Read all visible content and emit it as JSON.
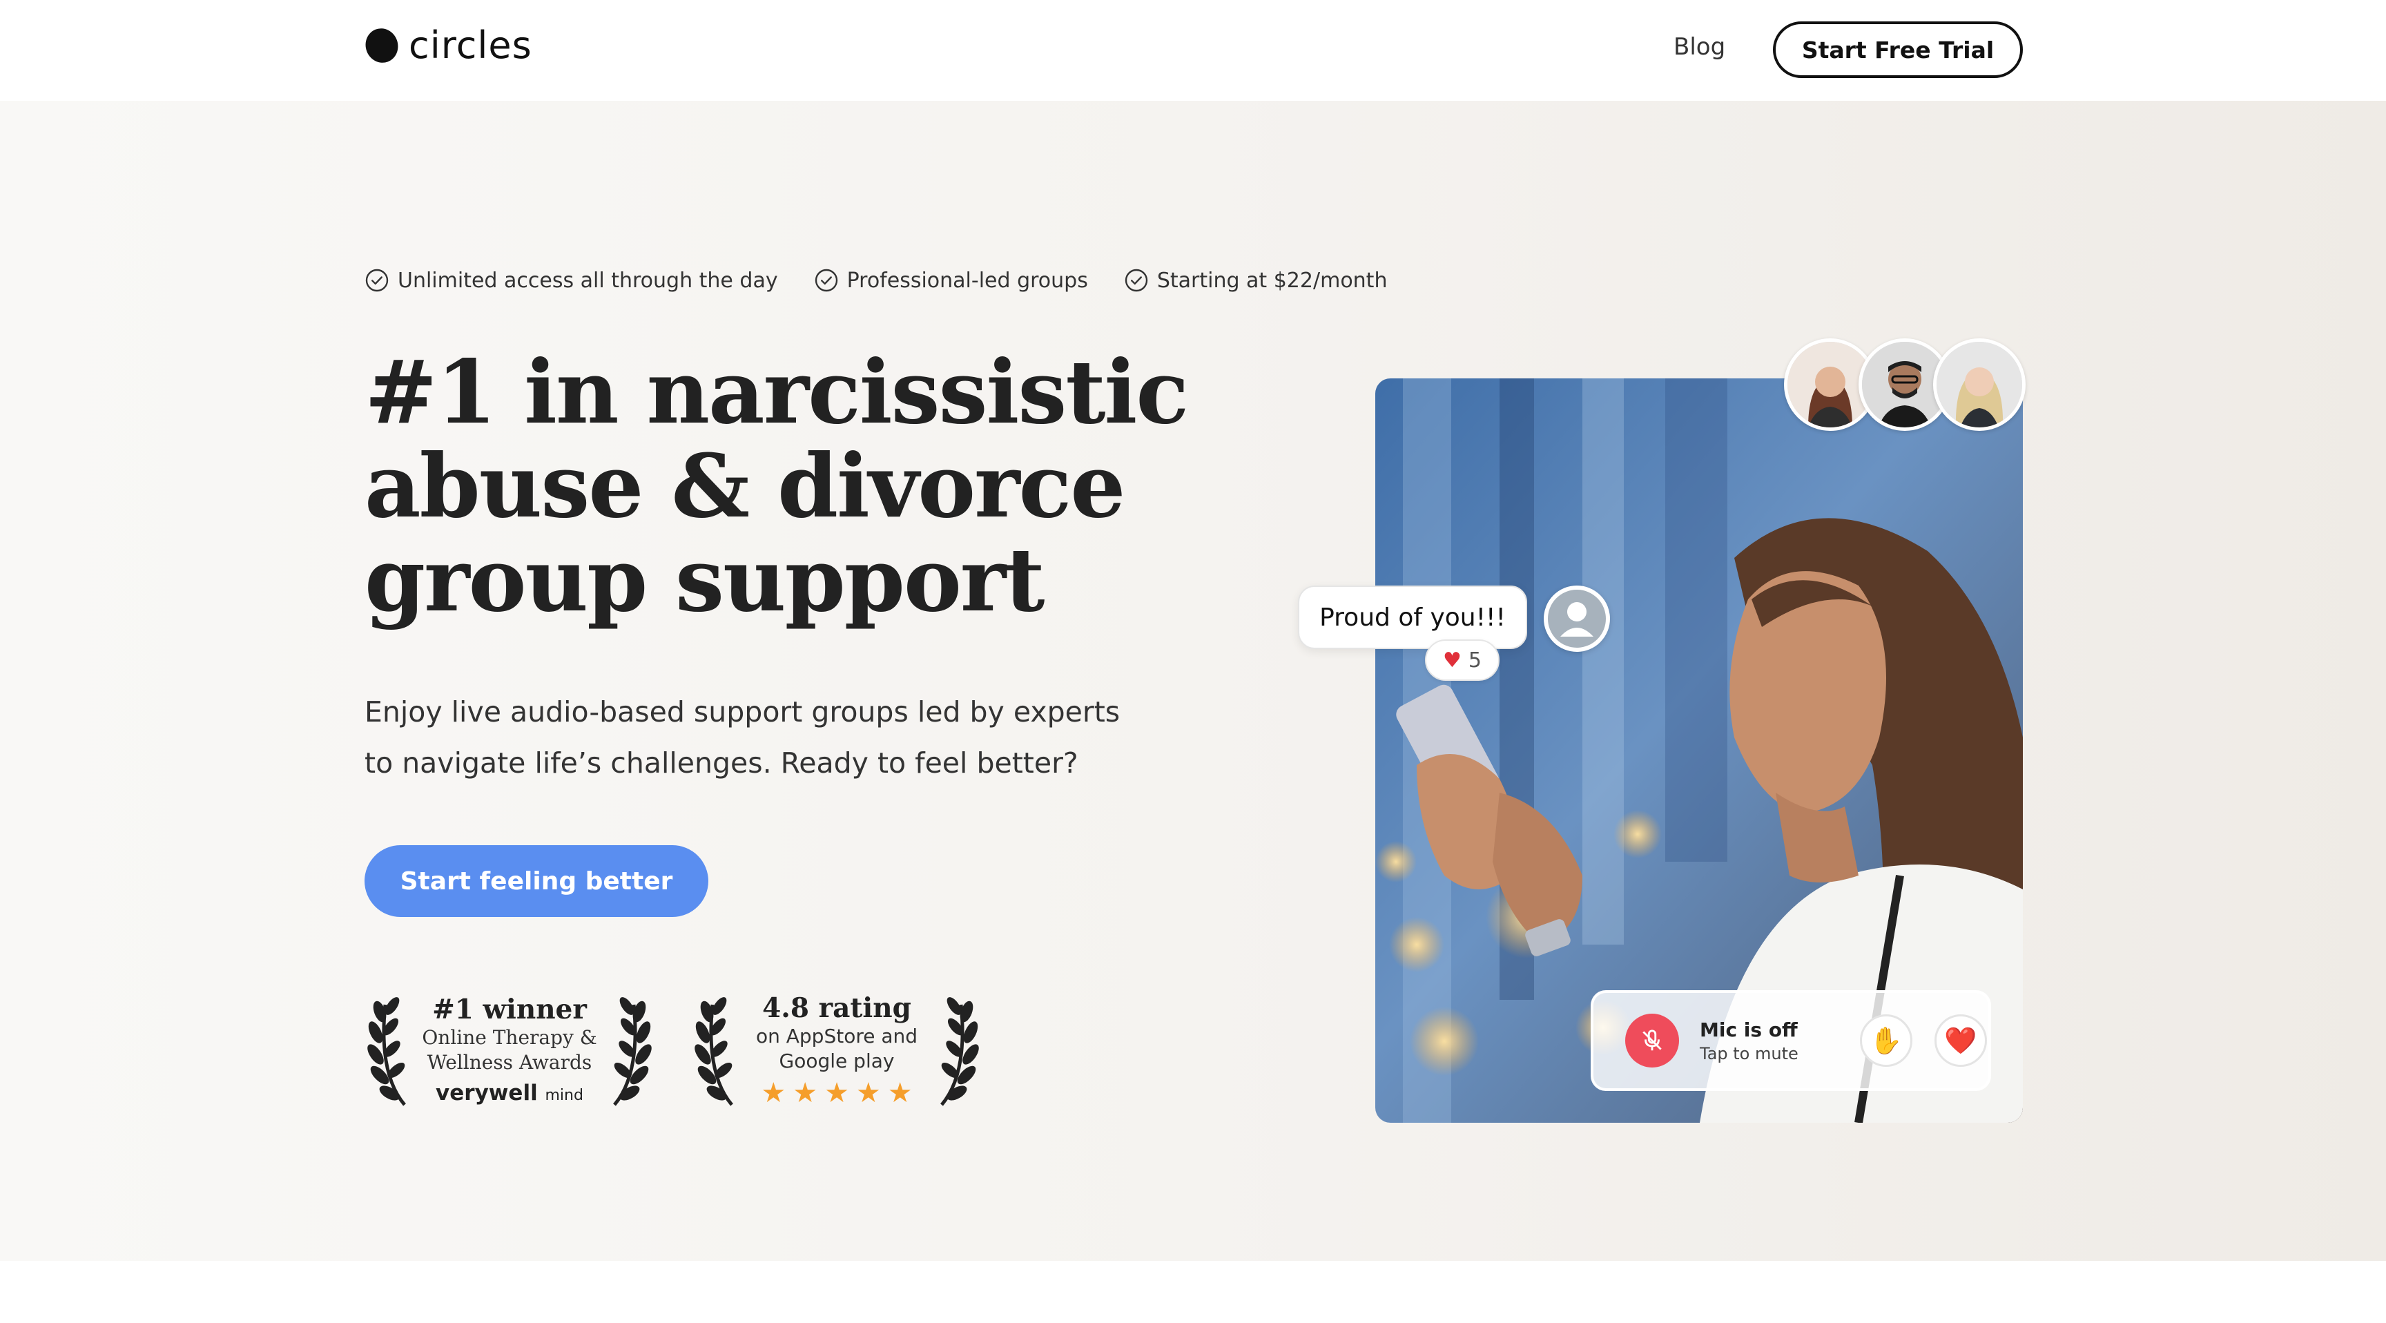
{
  "header": {
    "logo_text": "circles",
    "nav_blog": "Blog",
    "cta_label": "Start Free Trial"
  },
  "hero": {
    "perks": [
      {
        "label": "Unlimited access all through the day",
        "icon": "check-circle-icon"
      },
      {
        "label": "Professional-led groups",
        "icon": "check-circle-icon"
      },
      {
        "label": "Starting at $22/month",
        "icon": "check-circle-icon"
      }
    ],
    "headline_lines": [
      "#1 in narcissistic",
      "abuse & divorce",
      "group support"
    ],
    "subtext_lines": [
      "Enjoy live audio-based support groups led by experts",
      "to navigate life’s challenges. Ready to feel better?"
    ],
    "cta_label": "Start feeling better",
    "award_winner": {
      "title": "#1 winner",
      "line1": "Online Therapy &",
      "line2": "Wellness Awards",
      "brand_bold": "verywell",
      "brand_light": "mind"
    },
    "award_rating": {
      "title": "4.8 rating",
      "line1": "on AppStore and",
      "line2": "Google play",
      "stars": 5
    }
  },
  "visual": {
    "chat_message": "Proud of you!!!",
    "reaction_count": "5",
    "mic_title": "Mic is off",
    "mic_sub": "Tap to mute",
    "raise_hand_icon": "✋",
    "heart_icon": "❤️"
  },
  "colors": {
    "accent": "#5a8ef0",
    "star": "#f59e2b",
    "mic_red": "#ef4c5b"
  }
}
